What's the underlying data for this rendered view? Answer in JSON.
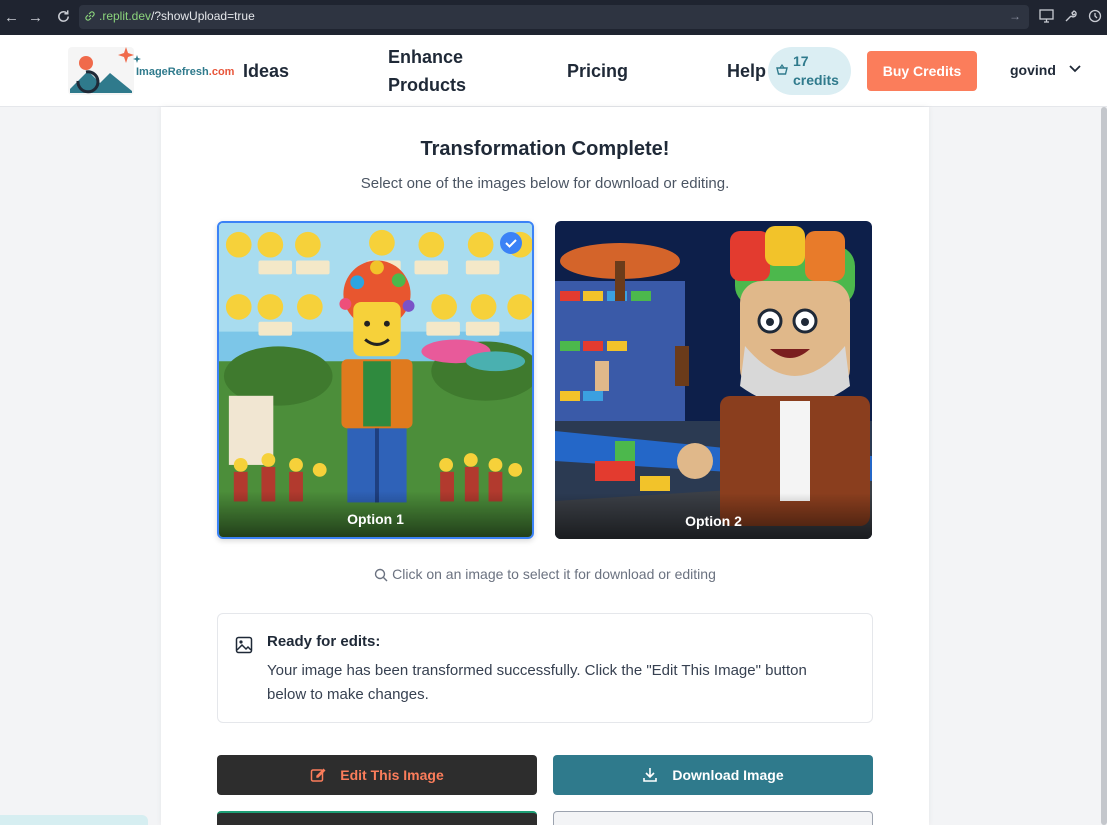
{
  "browser": {
    "url_host": ".replit.dev",
    "url_path": "/?showUpload=true"
  },
  "header": {
    "logo_text": "ImageRefresh",
    "logo_suffix": ".com",
    "nav": [
      {
        "label": "Ideas"
      },
      {
        "label": "Enhance"
      },
      {
        "label": "Products"
      },
      {
        "label": "Pricing"
      },
      {
        "label": "Help"
      }
    ],
    "credits_count": "17",
    "credits_label": "credits",
    "buy_label": "Buy Credits",
    "user_name": "govind"
  },
  "main": {
    "title": "Transformation Complete!",
    "subtitle": "Select one of the images below for download or editing.",
    "options": [
      {
        "label": "Option 1",
        "selected": true
      },
      {
        "label": "Option 2",
        "selected": false
      }
    ],
    "hint": "Click on an image to select it for download or editing",
    "ready_title": "Ready for edits:",
    "ready_text": "Your image has been transformed successfully. Click the \"Edit This Image\" button below to make changes.",
    "edit_button": "Edit This Image",
    "download_button": "Download Image"
  },
  "colors": {
    "accent": "#fb7d5b",
    "teal": "#2f7a8c",
    "selected": "#3b82f6"
  }
}
